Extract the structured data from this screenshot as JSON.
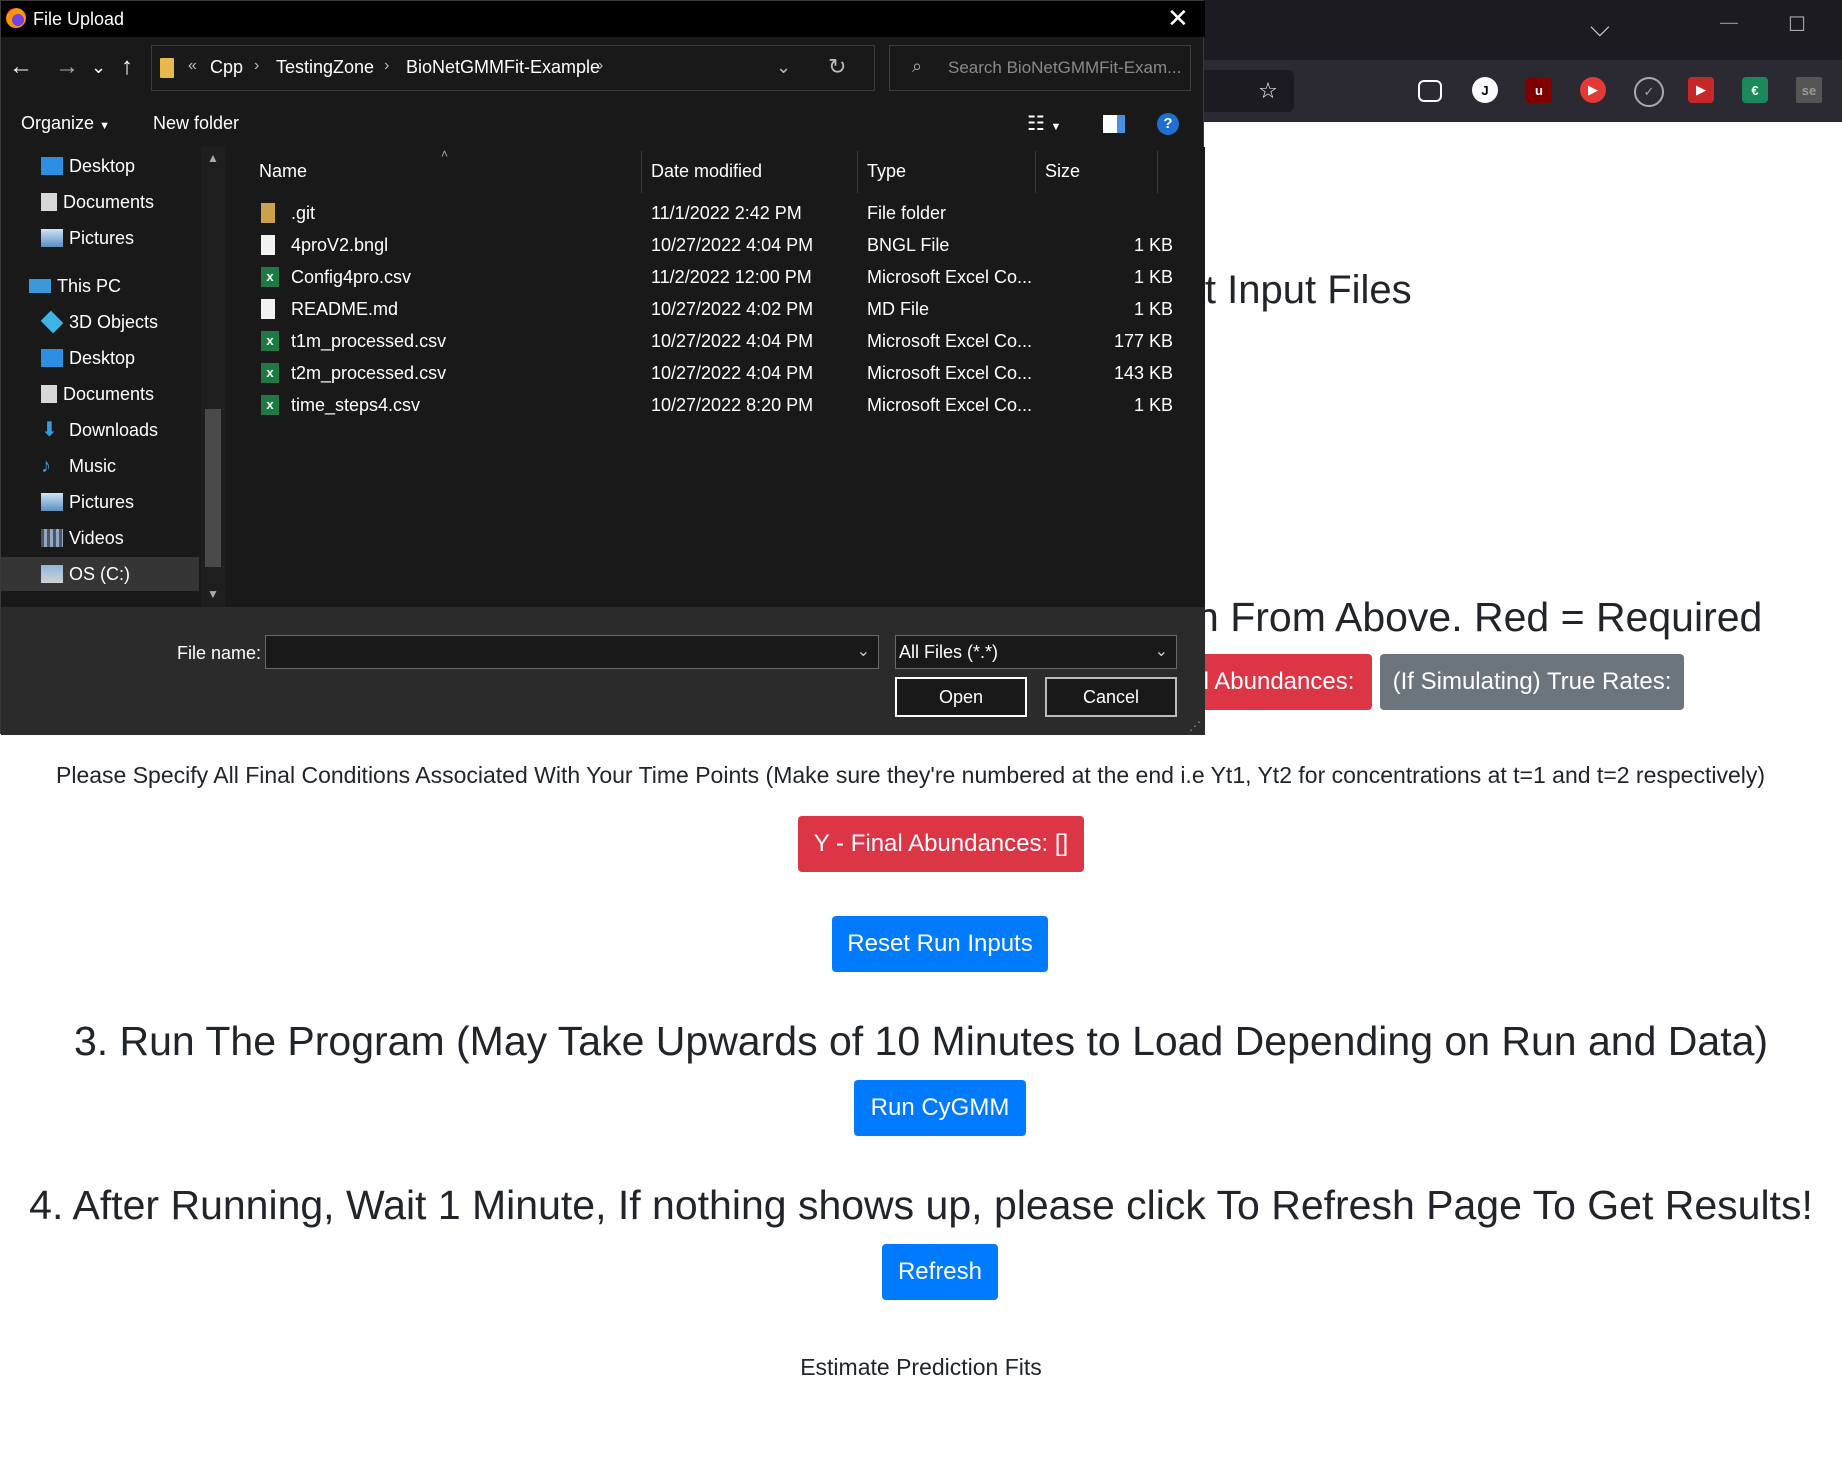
{
  "browser": {
    "chevron": "⌵",
    "minimize": "—",
    "maximize": "☐"
  },
  "page": {
    "heading_input_files": "it Input Files",
    "heading_from_above": "n From Above. Red = Required",
    "btn_initial_abundances": "l Abundances:",
    "btn_true_rates": "(If Simulating) True Rates:",
    "final_conditions_text": "Please Specify All Final Conditions Associated With Your Time Points (Make sure they're numbered at the end i.e Yt1, Yt2 for concentrations at t=1 and t=2 respectively)",
    "btn_final_abundances": "Y - Final Abundances: []",
    "btn_reset": "Reset Run Inputs",
    "heading_run": "3. Run The Program (May Take Upwards of 10 Minutes to Load Depending on Run and Data)",
    "btn_run": "Run CyGMM",
    "heading_after": "4. After Running, Wait 1 Minute, If nothing shows up, please click To Refresh Page To Get Results!",
    "btn_refresh": "Refresh",
    "estimate_text": "Estimate Prediction Fits"
  },
  "dialog": {
    "title": "File Upload",
    "breadcrumb": [
      "Cpp",
      "TestingZone",
      "BioNetGMMFit-Example"
    ],
    "breadcrumb_prefix": "«",
    "search_placeholder": "Search BioNetGMMFit-Exam...",
    "organize": "Organize",
    "new_folder": "New folder",
    "nav_items": [
      {
        "label": "Desktop",
        "icon": "desktop-icon"
      },
      {
        "label": "Documents",
        "icon": "documents-icon"
      },
      {
        "label": "Pictures",
        "icon": "pictures-icon"
      },
      {
        "label": "This PC",
        "icon": "computer-icon"
      },
      {
        "label": "3D Objects",
        "icon": "3d-objects-icon"
      },
      {
        "label": "Desktop",
        "icon": "desktop-icon"
      },
      {
        "label": "Documents",
        "icon": "documents-icon"
      },
      {
        "label": "Downloads",
        "icon": "downloads-icon"
      },
      {
        "label": "Music",
        "icon": "music-icon"
      },
      {
        "label": "Pictures",
        "icon": "pictures-icon"
      },
      {
        "label": "Videos",
        "icon": "videos-icon"
      },
      {
        "label": "OS (C:)",
        "icon": "drive-icon"
      }
    ],
    "columns": [
      "Name",
      "Date modified",
      "Type",
      "Size"
    ],
    "files": [
      {
        "name": ".git",
        "date": "11/1/2022 2:42 PM",
        "type": "File folder",
        "size": "",
        "icon": "folder-icon"
      },
      {
        "name": "4proV2.bngl",
        "date": "10/27/2022 4:04 PM",
        "type": "BNGL File",
        "size": "1 KB",
        "icon": "file-icon"
      },
      {
        "name": "Config4pro.csv",
        "date": "11/2/2022 12:00 PM",
        "type": "Microsoft Excel Co...",
        "size": "1 KB",
        "icon": "excel-icon"
      },
      {
        "name": "README.md",
        "date": "10/27/2022 4:02 PM",
        "type": "MD File",
        "size": "1 KB",
        "icon": "file-icon"
      },
      {
        "name": "t1m_processed.csv",
        "date": "10/27/2022 4:04 PM",
        "type": "Microsoft Excel Co...",
        "size": "177 KB",
        "icon": "excel-icon"
      },
      {
        "name": "t2m_processed.csv",
        "date": "10/27/2022 4:04 PM",
        "type": "Microsoft Excel Co...",
        "size": "143 KB",
        "icon": "excel-icon"
      },
      {
        "name": "time_steps4.csv",
        "date": "10/27/2022 8:20 PM",
        "type": "Microsoft Excel Co...",
        "size": "1 KB",
        "icon": "excel-icon"
      }
    ],
    "file_name_label": "File name:",
    "file_name_value": "",
    "file_type": "All Files (*.*)",
    "open": "Open",
    "cancel": "Cancel"
  },
  "colors": {
    "danger": "#dc3545",
    "secondary": "#6c757d",
    "primary": "#007bff"
  }
}
